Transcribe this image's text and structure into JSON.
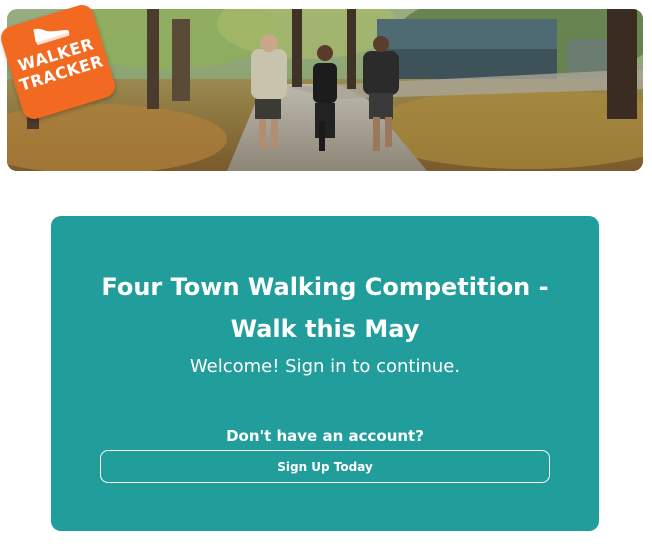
{
  "brand": {
    "logo_line1": "WALKER",
    "logo_line2": "TRACKER",
    "logo_color": "#f26a21",
    "icon": "sneaker-icon"
  },
  "hero": {
    "image": "people-walking-in-autumn-park-photo"
  },
  "card": {
    "background_color": "#219e9c",
    "title": "Four Town Walking Competition - Walk this May",
    "subtitle": "Welcome! Sign in to continue.",
    "account_prompt": "Don't have an account?",
    "signup_label": "Sign Up Today"
  }
}
